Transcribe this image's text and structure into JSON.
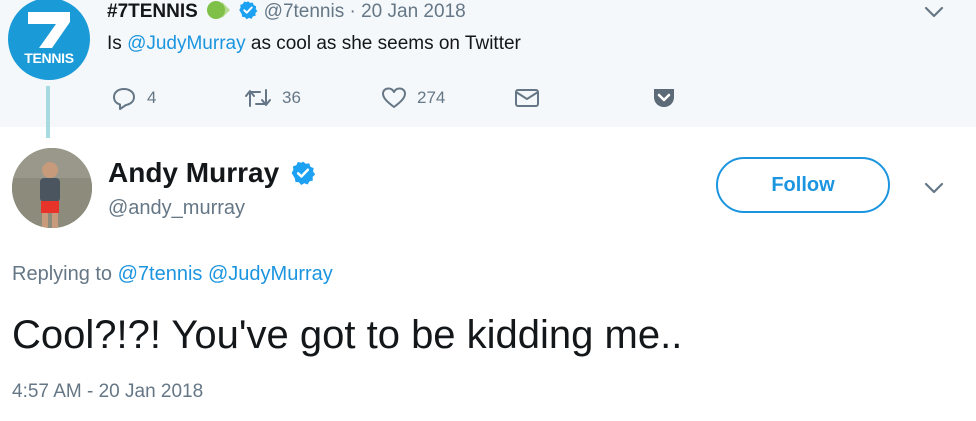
{
  "parent_tweet": {
    "display_name": "#7TENNIS",
    "handle": "@7tennis",
    "separator": "·",
    "date": "20 Jan 2018",
    "avatar_text": "TENNIS",
    "text_prefix": "Is ",
    "mention": "@JudyMurray",
    "text_suffix": " as cool as she seems on Twitter",
    "actions": {
      "replies": "4",
      "retweets": "36",
      "likes": "274"
    }
  },
  "tweet": {
    "display_name": "Andy Murray",
    "handle": "@andy_murray",
    "follow_label": "Follow",
    "replying_to_label": "Replying to",
    "replying_to": [
      "@7tennis",
      "@JudyMurray"
    ],
    "text": "Cool?!?! You've got to be kidding me..",
    "timestamp": "4:57 AM - 20 Jan 2018"
  },
  "icons": [
    "seven-logo-icon",
    "tennis-ball-icon",
    "verified-icon",
    "chevron-down-icon",
    "reply-icon",
    "retweet-icon",
    "like-icon",
    "message-icon",
    "pocket-icon"
  ],
  "colors": {
    "link": "#1b95e0",
    "verified": "#1da1f2",
    "muted": "#657786",
    "parent_bg": "#f5f8fa",
    "thread_line": "#a8dbe0",
    "avatar_bg": "#1b9ad8"
  }
}
